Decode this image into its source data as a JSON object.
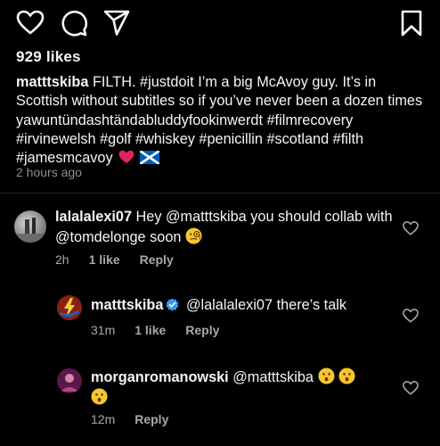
{
  "post": {
    "likes": "929 likes",
    "caption_user": "matttskiba",
    "caption_text": " FILTH. #justdoit I’m a big McAvoy guy. It’s in Scottish without subtitles so if you’ve never been a dozen times yawuntündashtändabluddyfookinwerdt #filmrecovery #irvinewelsh #golf #whiskey #penicillin #scotland #filth #jamesmcavoy ",
    "timestamp": "2 hours ago"
  },
  "comments": [
    {
      "user": "lalalalexi07",
      "text": " Hey @matttskiba you should collab with @tomdelonge soon ",
      "time": "2h",
      "likes": "1 like",
      "reply": "Reply",
      "emoji": "face-with-monocle"
    },
    {
      "user": "matttskiba",
      "verified": true,
      "text": " @lalalalexi07 there’s talk",
      "time": "31m",
      "likes": "1 like",
      "reply": "Reply"
    },
    {
      "user": "morganromanowski",
      "text": " @matttskiba ",
      "time": "12m",
      "reply": "Reply",
      "emoji": "hushed-face"
    }
  ],
  "icons": {
    "like": "heart-icon",
    "comment": "comment-icon",
    "share": "share-icon",
    "save": "bookmark-icon"
  },
  "colors": {
    "background": "#000000",
    "text": "#f5f5f5",
    "muted": "#8e8e8e",
    "heart_emoji": "#e0245e",
    "verified": "#3897f0"
  }
}
